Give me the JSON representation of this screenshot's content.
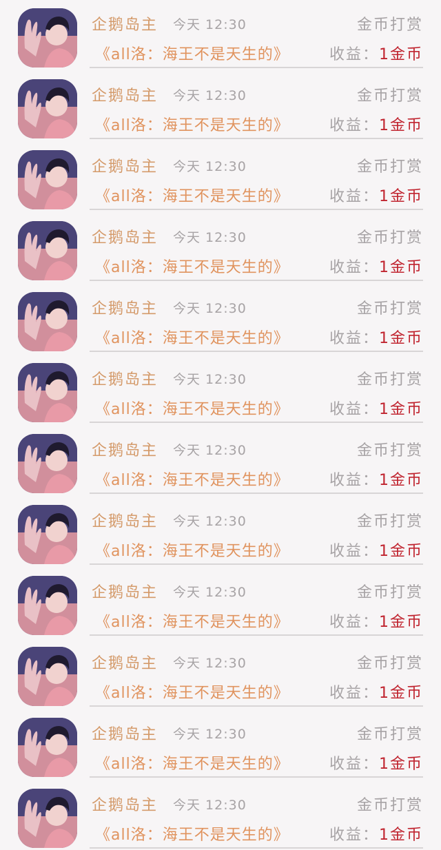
{
  "list": {
    "items": [
      {
        "sender": "企鹅岛主",
        "time": "今天 12:30",
        "tip_label": "金币打赏",
        "work_title": "《all洛：海王不是天生的》",
        "income_label": "收益：",
        "income_value": "1金币"
      },
      {
        "sender": "企鹅岛主",
        "time": "今天 12:30",
        "tip_label": "金币打赏",
        "work_title": "《all洛：海王不是天生的》",
        "income_label": "收益：",
        "income_value": "1金币"
      },
      {
        "sender": "企鹅岛主",
        "time": "今天 12:30",
        "tip_label": "金币打赏",
        "work_title": "《all洛：海王不是天生的》",
        "income_label": "收益：",
        "income_value": "1金币"
      },
      {
        "sender": "企鹅岛主",
        "time": "今天 12:30",
        "tip_label": "金币打赏",
        "work_title": "《all洛：海王不是天生的》",
        "income_label": "收益：",
        "income_value": "1金币"
      },
      {
        "sender": "企鹅岛主",
        "time": "今天 12:30",
        "tip_label": "金币打赏",
        "work_title": "《all洛：海王不是天生的》",
        "income_label": "收益：",
        "income_value": "1金币"
      },
      {
        "sender": "企鹅岛主",
        "time": "今天 12:30",
        "tip_label": "金币打赏",
        "work_title": "《all洛：海王不是天生的》",
        "income_label": "收益：",
        "income_value": "1金币"
      },
      {
        "sender": "企鹅岛主",
        "time": "今天 12:30",
        "tip_label": "金币打赏",
        "work_title": "《all洛：海王不是天生的》",
        "income_label": "收益：",
        "income_value": "1金币"
      },
      {
        "sender": "企鹅岛主",
        "time": "今天 12:30",
        "tip_label": "金币打赏",
        "work_title": "《all洛：海王不是天生的》",
        "income_label": "收益：",
        "income_value": "1金币"
      },
      {
        "sender": "企鹅岛主",
        "time": "今天 12:30",
        "tip_label": "金币打赏",
        "work_title": "《all洛：海王不是天生的》",
        "income_label": "收益：",
        "income_value": "1金币"
      },
      {
        "sender": "企鹅岛主",
        "time": "今天 12:30",
        "tip_label": "金币打赏",
        "work_title": "《all洛：海王不是天生的》",
        "income_label": "收益：",
        "income_value": "1金币"
      },
      {
        "sender": "企鹅岛主",
        "time": "今天 12:30",
        "tip_label": "金币打赏",
        "work_title": "《all洛：海王不是天生的》",
        "income_label": "收益：",
        "income_value": "1金币"
      },
      {
        "sender": "企鹅岛主",
        "time": "今天 12:30",
        "tip_label": "金币打赏",
        "work_title": "《all洛：海王不是天生的》",
        "income_label": "收益：",
        "income_value": "1金币"
      }
    ]
  },
  "colors": {
    "sender": "#d49a6a",
    "work_title": "#e0935e",
    "muted": "#a7a3a5",
    "income_value": "#c0242f",
    "divider": "#d8d5d6",
    "background": "#f7f5f6"
  },
  "icons": {
    "avatar": "user-avatar-photo"
  }
}
